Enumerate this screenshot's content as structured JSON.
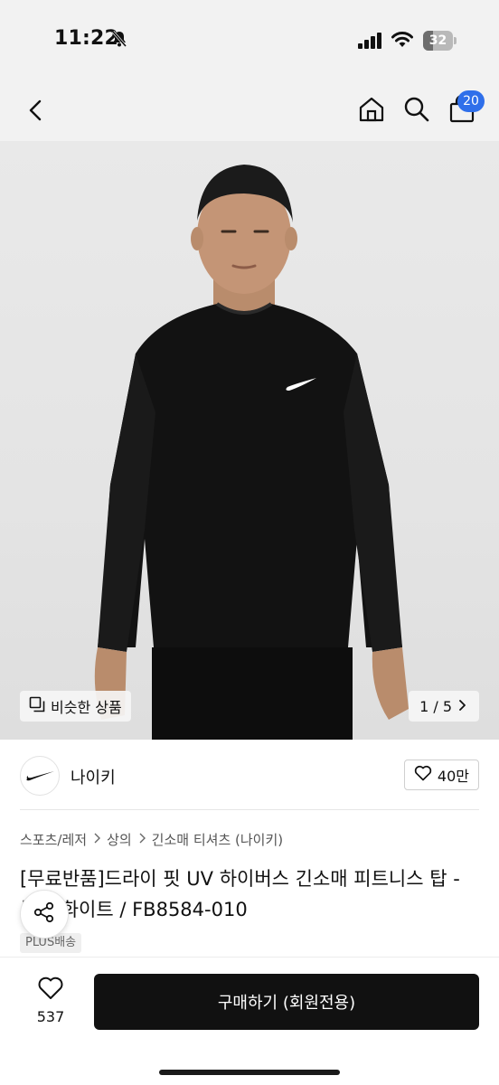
{
  "status_bar": {
    "time": "11:22",
    "battery": "32",
    "battery_level_percent": 32
  },
  "top_nav": {
    "cart_count": "20"
  },
  "hero": {
    "similar_label": "비슷한 상품",
    "pager_label": "1 / 5"
  },
  "brand": {
    "name": "나이키",
    "like_count": "40만"
  },
  "breadcrumb": {
    "items": [
      "스포츠/레저",
      "상의",
      "긴소매 티셔츠 (나이키)"
    ]
  },
  "product": {
    "title": "[무료반품]드라이 핏 UV 하이버스 긴소매 피트니스 탑 - 블랙:화이트 / FB8584-010",
    "shipping_badge": "PLUS배송"
  },
  "bottom_bar": {
    "wish_count": "537",
    "buy_label": "구매하기 (회원전용)"
  },
  "colors": {
    "accent_badge": "#2f6fea",
    "buy_button": "#111111"
  }
}
